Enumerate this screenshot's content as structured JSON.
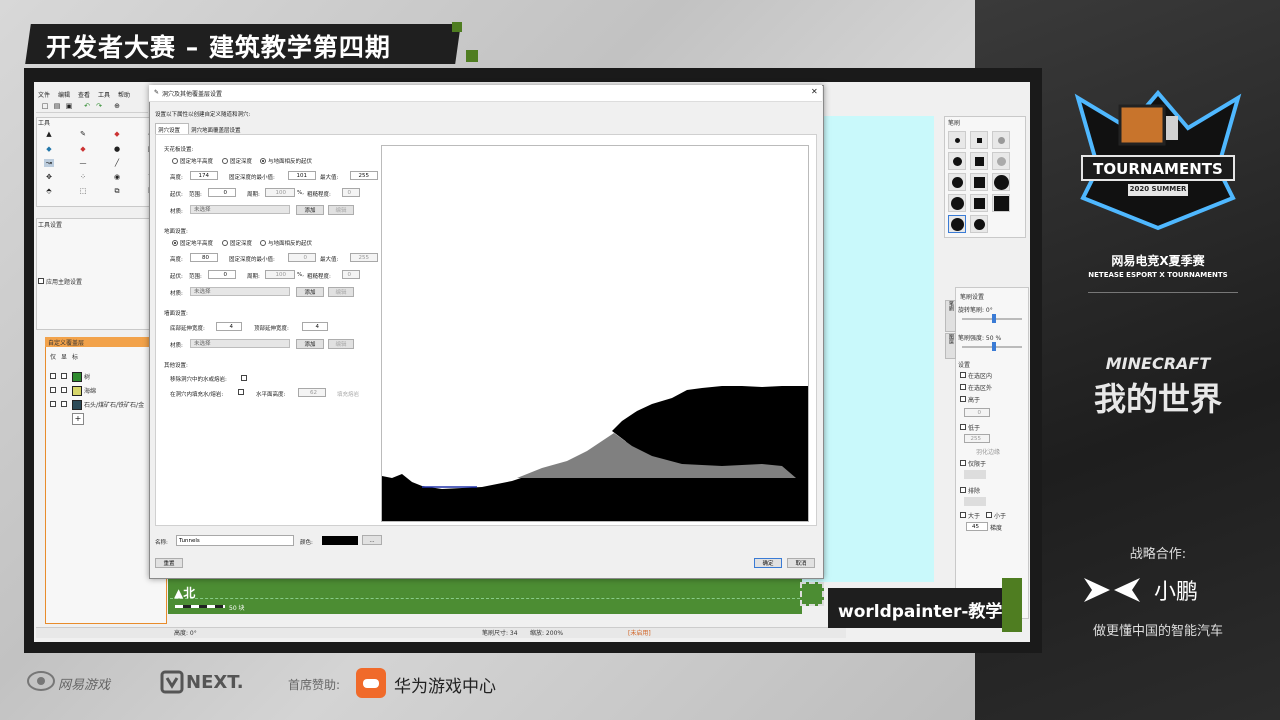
{
  "overlay": {
    "title": "开发者大赛 – 建筑教学第四期",
    "event_cn": "网易电竞X夏季赛",
    "event_en": "NETEASE ESPORT X TOURNAMENTS",
    "badge_main": "TOURNAMENTS",
    "badge_sub": "2020 SUMMER",
    "minecraft_en": "MINECRAFT",
    "minecraft_cn": "我的世界",
    "partner_label": "战略合作:",
    "partner_name": "小鹏",
    "partner_slogan": "做更懂中国的智能汽车",
    "caption": "worldpainter-教学",
    "sponsor_label": "首席赞助:",
    "sponsor_name": "华为游戏中心",
    "netease_game": "网易游戏",
    "next_logo": "NEXT."
  },
  "app": {
    "menu": [
      "文件",
      "编辑",
      "查看",
      "工具",
      "帮助"
    ],
    "tools_panel_title": "工具",
    "tool_settings_title": "工具设置",
    "apply_theme_label": "应用主题设置",
    "layers_panel_title": "自定义覆盖层",
    "layers_col_headers": [
      "仅",
      "显",
      "标"
    ],
    "layers": [
      {
        "name": "树",
        "color": "#2e8b2e"
      },
      {
        "name": "海绵",
        "color": "#d6d66a"
      },
      {
        "name": "石头/煤矿石/铁矿石/金",
        "color": "#2b4a57"
      }
    ],
    "add_layer": "+",
    "compass": "北",
    "scale": "50 块",
    "status": {
      "height": "高度: 0°",
      "brush": "笔刷尺寸: 34",
      "zoom": "缩放: 200%",
      "mode": "[未启用]"
    },
    "brush_panel_title": "笔刷",
    "brush_settings_title": "笔刷设置",
    "rotation_label": "旋转笔刷: 0°",
    "intensity_label": "笔刷强度: 50 %",
    "settings_title": "设置",
    "side_tabs": [
      "笔刷",
      "图层"
    ],
    "settings_items": [
      "在选区内",
      "在选区外",
      "高于",
      "低于",
      "仅限于",
      "排除",
      "大于",
      "小于"
    ],
    "settings_values": {
      "above": "0",
      "below": "255",
      "interpolate": "羽化边缘",
      "bigger": "45",
      "smaller_unit": "梯度"
    }
  },
  "dialog": {
    "title": "洞穴及其他覆盖层设置",
    "description": "设置以下属性以创建自定义隧道和洞穴:",
    "tabs": [
      "洞穴设置",
      "洞穴地面覆盖层设置"
    ],
    "roof": {
      "section": "天花板设置:",
      "modes": [
        "固定地平高度",
        "固定深度",
        "与地面相反的起伏"
      ],
      "height_label": "高度:",
      "height_value": "174",
      "min_label": "固定深度的最小值:",
      "min_value": "101",
      "max_label": "最大值:",
      "max_value": "255",
      "wave_label": "起伏:",
      "amp_label": "范围:",
      "amp_value": "0",
      "period_label": "周期:",
      "period_value": "100",
      "pct": "%,",
      "rough_label": "粗糙程度:",
      "rough_value": "0",
      "material_label": "材质:",
      "material_value": "未选择",
      "add": "添加",
      "edit": "编辑"
    },
    "floor": {
      "section": "地面设置:",
      "modes": [
        "固定地平高度",
        "固定深度",
        "与地面相反的起伏"
      ],
      "height_label": "高度:",
      "height_value": "80",
      "min_label": "固定深度的最小值:",
      "min_value": "0",
      "max_label": "最大值:",
      "max_value": "255",
      "wave_label": "起伏:",
      "amp_label": "范围:",
      "amp_value": "0",
      "period_label": "周期:",
      "period_value": "100",
      "pct": "%,",
      "rough_label": "粗糙程度:",
      "rough_value": "0",
      "material_label": "材质:",
      "material_value": "未选择",
      "add": "添加",
      "edit": "编辑"
    },
    "wall": {
      "section": "墙面设置:",
      "bottom_label": "底部延伸宽度:",
      "bottom_value": "4",
      "top_label": "顶部延伸宽度:",
      "top_value": "4",
      "material_label": "材质:",
      "material_value": "未选择",
      "add": "添加",
      "edit": "编辑"
    },
    "other": {
      "section": "其他设置:",
      "remove_water": "移除洞穴中的水或熔岩:",
      "fill_water": "在洞穴内填充水/熔岩:",
      "water_level_label": "水平面高度:",
      "water_level_value": "62",
      "fill_lava": "填充熔岩"
    },
    "name_label": "名称:",
    "name_value": "Tunnels",
    "color_label": "颜色:",
    "color_value": "#000000",
    "color_button": "...",
    "reset": "重置",
    "ok": "确定",
    "cancel": "取消"
  }
}
